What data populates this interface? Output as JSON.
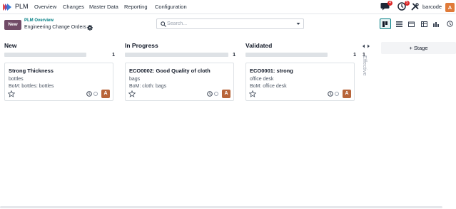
{
  "navbar": {
    "app_name": "PLM",
    "menu": [
      "Overview",
      "Changes",
      "Master Data",
      "Reporting",
      "Configuration"
    ],
    "messages_count": "4",
    "activities_count": "5",
    "company": "barcode",
    "user_initial": "A"
  },
  "control_panel": {
    "new_label": "New",
    "breadcrumb_parent": "PLM Overview",
    "breadcrumb_current": "Engineering Change Orders",
    "search_placeholder": "Search..."
  },
  "kanban": {
    "columns": [
      {
        "title": "New",
        "count": "1",
        "cards": [
          {
            "title": "Strong Thickness",
            "product": "bottles",
            "bom": "BoM: bottles: bottles",
            "avatar": "A"
          }
        ]
      },
      {
        "title": "In Progress",
        "count": "1",
        "cards": [
          {
            "title": "ECO0002: Good Quality of cloth",
            "product": "bags",
            "bom": "BoM: cloth: bags",
            "avatar": "A"
          }
        ]
      },
      {
        "title": "Validated",
        "count": "1",
        "cards": [
          {
            "title": "ECO0001: strong",
            "product": "office desk",
            "bom": "BoM: office desk",
            "avatar": "A"
          }
        ]
      }
    ],
    "folded_column": {
      "title": "Effective",
      "count": "1"
    },
    "add_stage_label": "+ Stage"
  },
  "colors": {
    "brand": "#714b67",
    "accent": "#017e84",
    "avatar": "#b8653a",
    "badge": "#dc2626"
  }
}
